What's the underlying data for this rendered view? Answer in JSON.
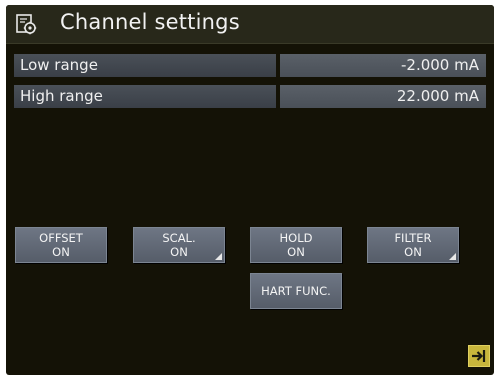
{
  "header": {
    "title": "Channel settings",
    "icon": "settings-page-icon"
  },
  "settings": [
    {
      "label": "Low range",
      "value": "-2.000 mA"
    },
    {
      "label": "High range",
      "value": "22.000 mA"
    }
  ],
  "buttons": {
    "offset": {
      "line1": "OFFSET",
      "line2": "ON"
    },
    "scal": {
      "line1": "SCAL.",
      "line2": "ON"
    },
    "hold": {
      "line1": "HOLD",
      "line2": "ON"
    },
    "filter": {
      "line1": "FILTER",
      "line2": "ON"
    },
    "hart": {
      "label": "HART FUNC."
    }
  },
  "footer": {
    "exit_icon": "exit-arrow-icon"
  },
  "colors": {
    "screen_bg": "#141206",
    "button_bg": "#6e7684",
    "exit_accent": "#c8b63c"
  }
}
